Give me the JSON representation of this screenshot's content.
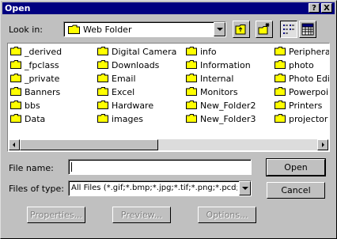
{
  "title": "Open",
  "title_buttons": {
    "help": "?",
    "close": "X"
  },
  "look_in": {
    "label": "Look in:",
    "value": "Web Folder",
    "icon": "folder-icon"
  },
  "toolbar": [
    {
      "name": "up-one-level-button",
      "icon": "up-folder-icon"
    },
    {
      "name": "create-new-folder-button",
      "icon": "new-folder-icon"
    },
    {
      "name": "list-view-button",
      "icon": "list-view-icon",
      "pressed": true
    },
    {
      "name": "details-view-button",
      "icon": "details-view-icon"
    }
  ],
  "files": {
    "columns": [
      [
        "_derived",
        "_fpclass",
        "_private",
        "Banners",
        "bbs",
        "Data"
      ],
      [
        "Digital Camera",
        "Downloads",
        "Email",
        "Excel",
        "Hardware",
        "images"
      ],
      [
        "info",
        "Information",
        "Internal",
        "Monitors",
        "New_Folder2",
        "New_Folder3"
      ],
      [
        "Peripherals",
        "photo",
        "Photo Edit",
        "Powerpoin",
        "Printers",
        "projector"
      ]
    ]
  },
  "file_name": {
    "label": "File name:",
    "value": ""
  },
  "file_type": {
    "label": "Files of type:",
    "value": "All Files (*.gif;*.bmp;*.jpg;*.tif;*.png;*.pcd;*.pc"
  },
  "buttons": {
    "open": "Open",
    "cancel": "Cancel",
    "properties": "Properties...",
    "preview": "Preview...",
    "options": "Options..."
  },
  "colors": {
    "titlebar": "#000080",
    "folder": "#ffff00",
    "face": "#c0c0c0"
  }
}
